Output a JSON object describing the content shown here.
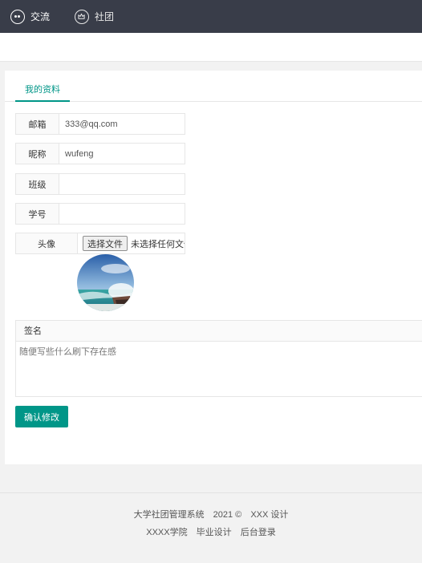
{
  "nav": {
    "items": [
      {
        "label": "交流",
        "icon": "chat-bubble-icon"
      },
      {
        "label": "社团",
        "icon": "crown-icon"
      }
    ]
  },
  "tabs": [
    {
      "label": "我的资料",
      "active": true
    }
  ],
  "form": {
    "email": {
      "label": "邮箱",
      "value": "333@qq.com"
    },
    "nickname": {
      "label": "昵称",
      "value": "wufeng"
    },
    "class": {
      "label": "班级",
      "value": ""
    },
    "student_id": {
      "label": "学号",
      "value": ""
    },
    "avatar": {
      "label": "头像",
      "button": "选择文件",
      "status": "未选择任何文件"
    }
  },
  "signature": {
    "label": "签名",
    "placeholder": "随便写些什么刷下存在感"
  },
  "submit_label": "确认修改",
  "footer": {
    "system": "大学社团管理系统",
    "year": "2021 ©",
    "design": "XXX 设计",
    "links": [
      "XXXX学院",
      "毕业设计",
      "后台登录"
    ]
  },
  "colors": {
    "accent": "#009688",
    "topbar": "#393d49"
  }
}
